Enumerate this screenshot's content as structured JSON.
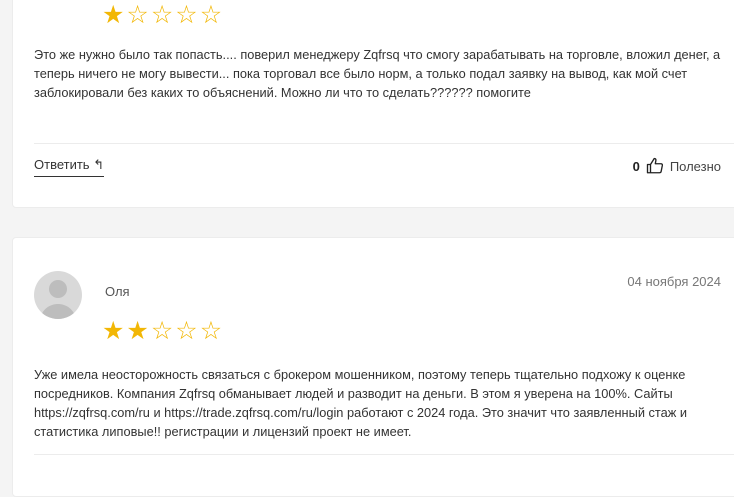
{
  "reviews": [
    {
      "rating": 1,
      "text": "Это же нужно было так попасть.... поверил менеджеру Zqfrsq что смогу зарабатывать на торговле, вложил денег, а теперь ничего не могу вывести... пока торговал все было норм, а только подал заявку на вывод, как мой счет заблокировали без каких то объяснений. Можно ли что то сделать?????? помогите",
      "reply_label": "Ответить",
      "helpful_count": "0",
      "helpful_label": "Полезно"
    },
    {
      "author": "Оля",
      "date": "04 ноября 2024",
      "rating": 2,
      "text": "Уже имела неосторожность связаться с брокером мошенником, поэтому теперь тщательно подхожу к оценке посредников. Компания Zqfrsq обманывает людей и разводит на деньги. В этом я уверена на 100%. Сайты https://zqfrsq.com/ru и https://trade.zqfrsq.com/ru/login работают с 2024 года. Это значит что заявленный стаж и статистика липовые!! регистрации и лицензий проект не имеет."
    }
  ],
  "icons": {
    "reply": "reply-arrow-icon",
    "helpful": "thumbs-up-icon",
    "avatar": "user-avatar-icon"
  },
  "colors": {
    "star": "#f2b705"
  }
}
